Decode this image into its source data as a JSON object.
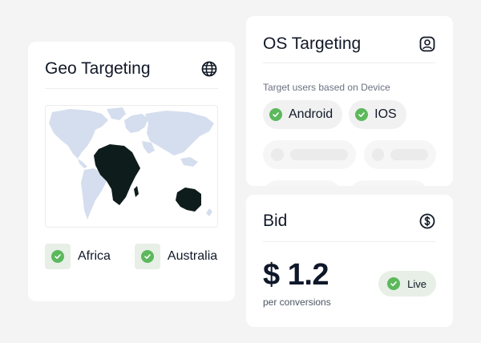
{
  "geo": {
    "title": "Geo Targeting",
    "title_icon": "globe-icon",
    "regions": [
      {
        "label": "Africa",
        "checked": true
      },
      {
        "label": "Australia",
        "checked": true
      }
    ],
    "map_highlight_color": "#0f1c1c",
    "map_base_color": "#d5deee"
  },
  "os": {
    "title": "OS Targeting",
    "title_icon": "user-circle-icon",
    "subtitle": "Target users based on Device",
    "options": [
      {
        "label": "Android",
        "checked": true
      },
      {
        "label": "IOS",
        "checked": true
      }
    ]
  },
  "bid": {
    "title": "Bid",
    "title_icon": "dollar-circle-icon",
    "price": "$ 1.2",
    "unit": "per conversions",
    "status": "Live"
  },
  "colors": {
    "accent_green": "#5cb85c",
    "check_bg": "#e7efe6"
  }
}
